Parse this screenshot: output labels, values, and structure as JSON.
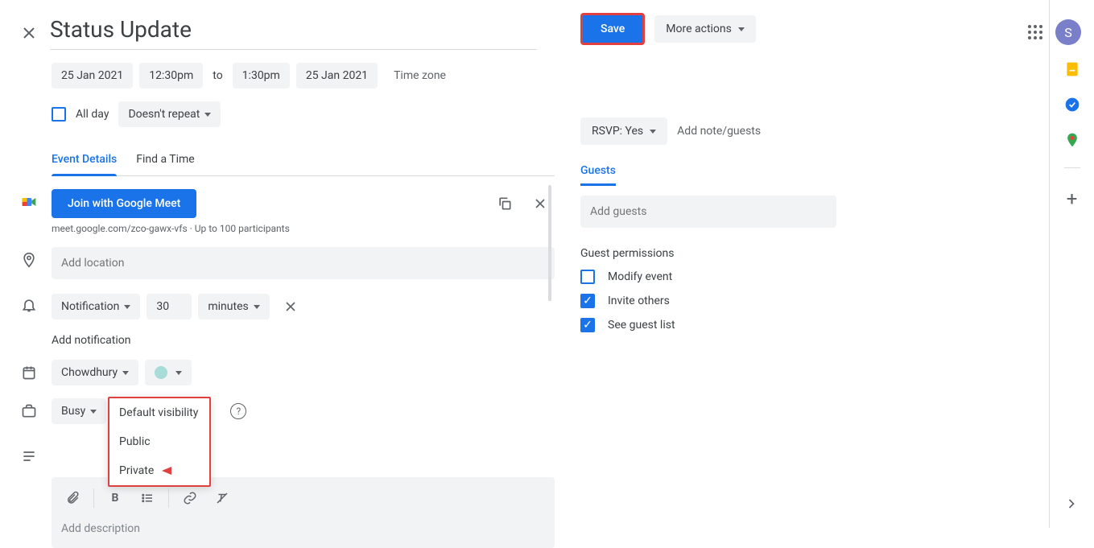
{
  "header": {
    "title": "Status Update"
  },
  "datetime": {
    "start_date": "25 Jan 2021",
    "start_time": "12:30pm",
    "to": "to",
    "end_time": "1:30pm",
    "end_date": "25 Jan 2021",
    "timezone": "Time zone"
  },
  "allday": {
    "label": "All day",
    "repeat": "Doesn't repeat"
  },
  "tabs": {
    "details": "Event Details",
    "findtime": "Find a Time"
  },
  "meet": {
    "join": "Join with Google Meet",
    "url": "meet.google.com/zco-gawx-vfs  ·  Up to 100 participants"
  },
  "location": {
    "placeholder": "Add location"
  },
  "notification": {
    "type": "Notification",
    "value": "30",
    "unit": "minutes",
    "add": "Add notification"
  },
  "calendar": {
    "name": "Chowdhury"
  },
  "availability": {
    "busy": "Busy"
  },
  "visibility": {
    "default": "Default visibility",
    "public": "Public",
    "private": "Private"
  },
  "description": {
    "placeholder": "Add description"
  },
  "actions": {
    "save": "Save",
    "more": "More actions"
  },
  "rsvp": {
    "label": "RSVP: Yes",
    "addnote": "Add note/guests"
  },
  "guests": {
    "tab": "Guests",
    "placeholder": "Add guests",
    "perms_title": "Guest permissions",
    "modify": "Modify event",
    "invite": "Invite others",
    "seelist": "See guest list"
  },
  "avatar": {
    "letter": "S"
  }
}
